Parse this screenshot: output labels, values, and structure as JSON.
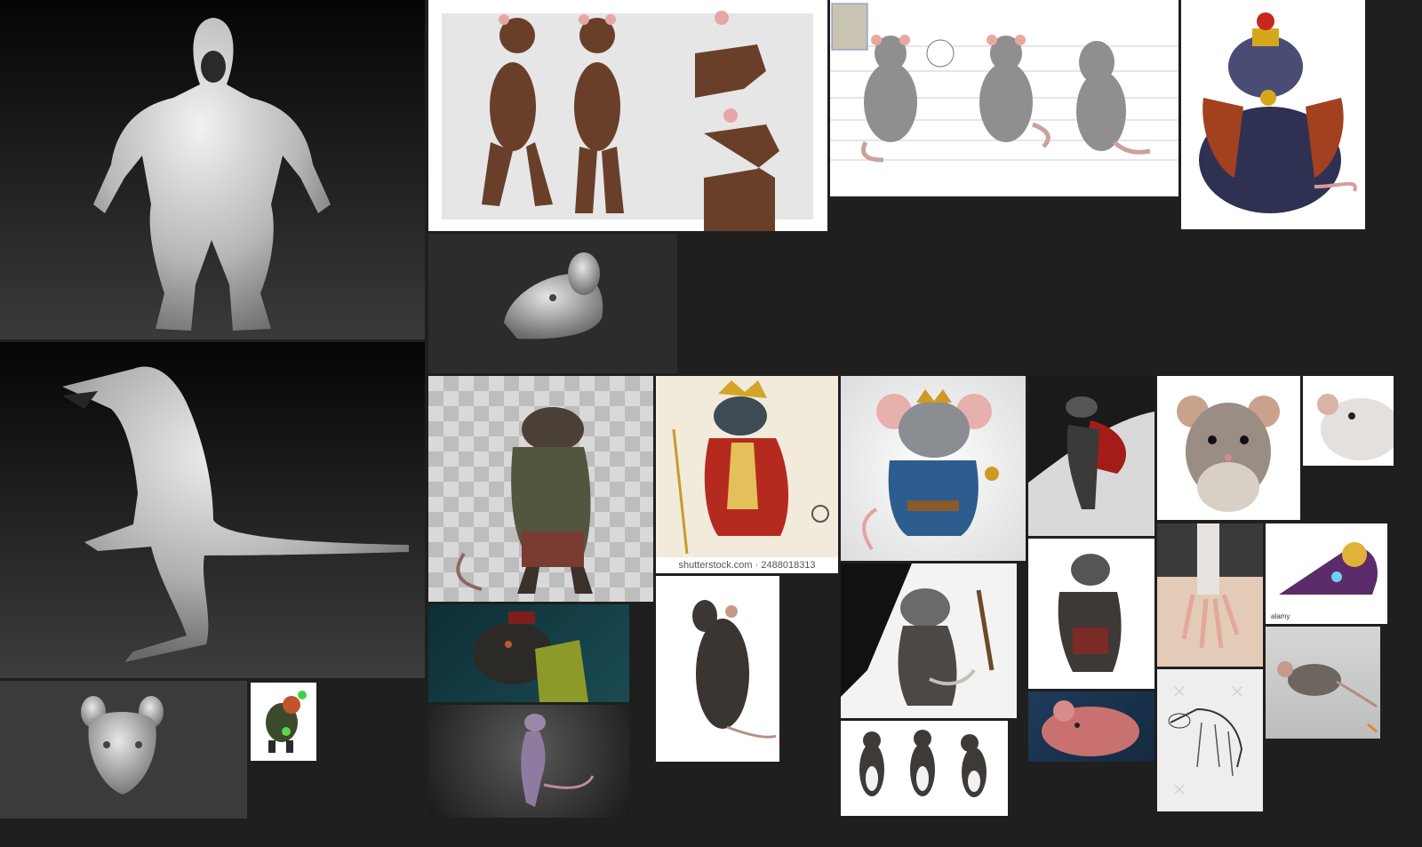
{
  "board": {
    "background": "#1f1f1f"
  },
  "tiles": {
    "sculpt_front": {
      "icon": "rat-sculpt-front-icon"
    },
    "sculpt_side": {
      "icon": "rat-sculpt-side-icon"
    },
    "sculpt_head_front": {
      "icon": "rat-head-sculpt-icon"
    },
    "brown_rat_sheet": {
      "icon": "rat-turnaround-sheet-icon"
    },
    "grey_rat_sheet": {
      "icon": "rat-model-sheet-icon"
    },
    "fat_rat_king": {
      "icon": "rat-king-fat-icon"
    },
    "head_sculpt_side": {
      "icon": "rat-head-side-sculpt-icon"
    },
    "tiny_rat_thumb": {
      "icon": "rat-thumbnail-icon"
    },
    "armored_rat": {
      "icon": "armored-rat-warrior-icon"
    },
    "crowned_rat": {
      "icon": "crowned-rat-king-icon",
      "caption": "shutterstock.com · 2488018313"
    },
    "cartoon_rat_king": {
      "icon": "cartoon-rat-king-icon"
    },
    "ink_rat_red": {
      "icon": "ink-rat-red-cape-icon"
    },
    "cute_rat": {
      "icon": "cute-rat-photo-icon"
    },
    "white_rat_crop": {
      "icon": "white-rat-photo-icon"
    },
    "dark_rat_portrait": {
      "icon": "dark-rat-portrait-icon"
    },
    "purple_rat_render": {
      "icon": "purple-rat-render-icon"
    },
    "standing_rat": {
      "icon": "standing-rat-photo-icon"
    },
    "rat_warrior_ink": {
      "icon": "rat-warrior-ink-icon"
    },
    "rat_knight": {
      "icon": "rat-knight-icon"
    },
    "pink_rat_render": {
      "icon": "pink-rat-render-icon"
    },
    "rat_paw": {
      "icon": "rat-paw-photo-icon"
    },
    "rat_xray_head": {
      "icon": "rat-xray-head-icon",
      "watermark": "alamy"
    },
    "running_rat": {
      "icon": "running-rat-photo-icon"
    },
    "rat_skeleton": {
      "icon": "rat-skeleton-diagram-icon"
    },
    "three_rats": {
      "icon": "three-rats-photo-icon"
    }
  }
}
